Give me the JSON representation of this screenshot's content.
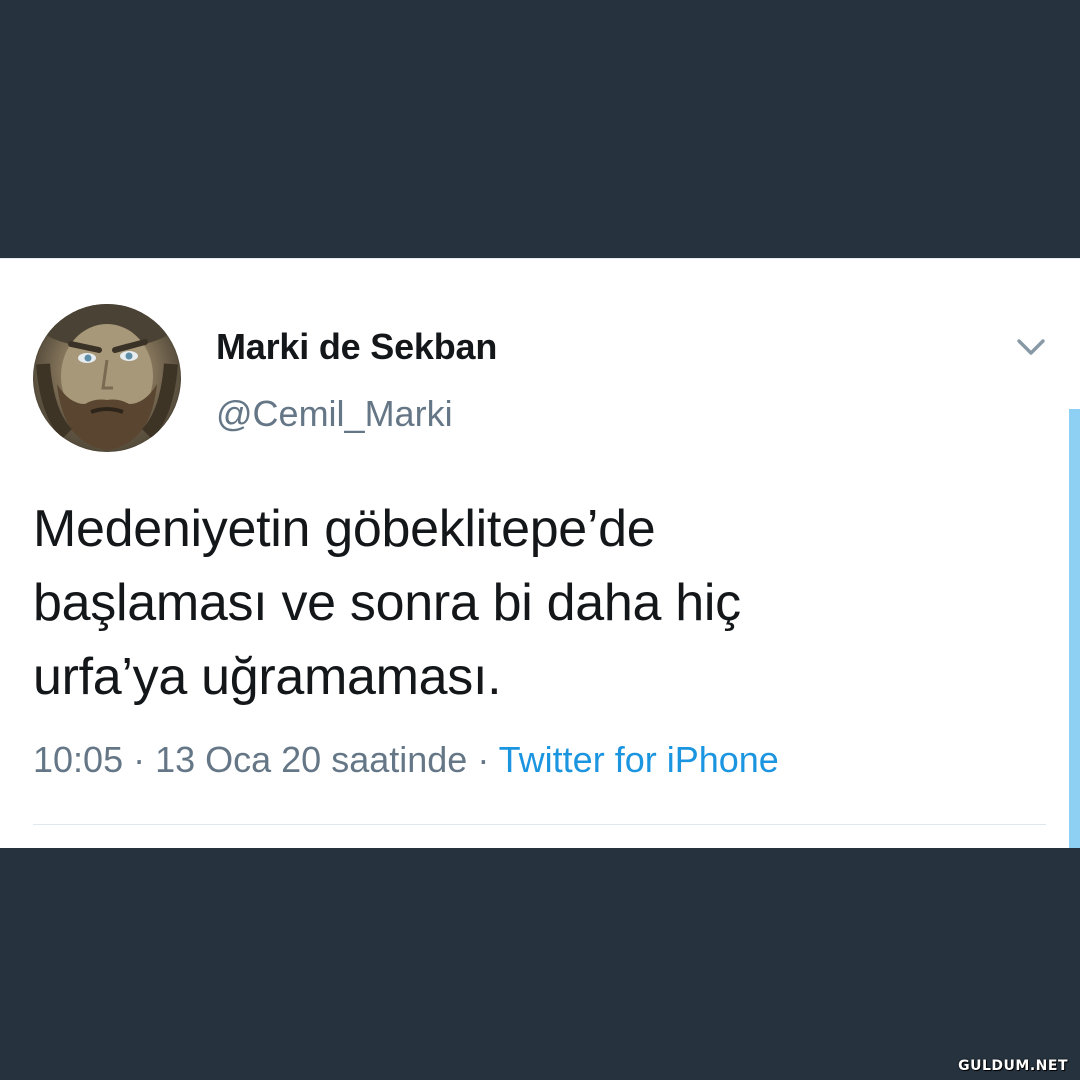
{
  "tweet": {
    "display_name": "Marki de Sekban",
    "handle": "@Cemil_Marki",
    "text_lines": [
      "Medeniyetin göbeklitepe’de",
      "başlaması ve sonra bi daha hiç",
      "urfa’ya uğramaması."
    ],
    "meta": {
      "time": "10:05",
      "separator": " · ",
      "date": "13 Oca 20 saatinde",
      "source": "Twitter for iPhone"
    },
    "avatar_icon": "profile-photo-icon",
    "menu_icon": "chevron-down-icon"
  },
  "watermark": "GULDUM.NET",
  "colors": {
    "background": "#26333f",
    "card": "#ffffff",
    "text_primary": "#14171a",
    "text_secondary": "#657786",
    "link": "#1b95e0"
  }
}
